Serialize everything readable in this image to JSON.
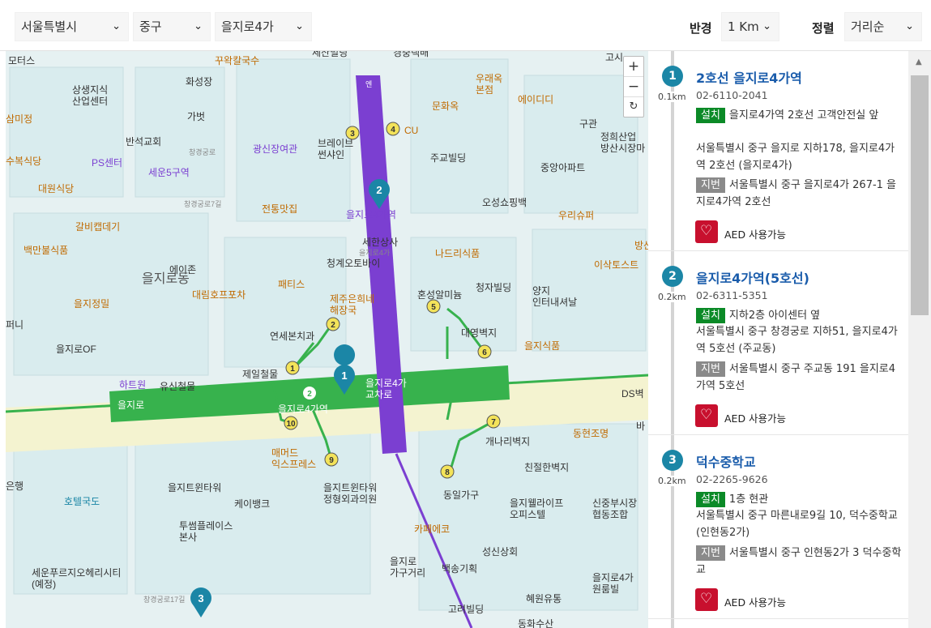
{
  "filters": {
    "city": "서울특별시",
    "district": "중구",
    "dong": "을지로4가",
    "radius_label": "반경",
    "radius": "1 Km",
    "sort_label": "정렬",
    "sort": "거리순"
  },
  "map": {
    "zoom_in": "+",
    "zoom_out": "−",
    "reset": "↻",
    "markers": [
      {
        "num": "1"
      },
      {
        "num": "2"
      },
      {
        "num": "3"
      }
    ],
    "labels": {
      "l1": "모터스",
      "l2": "꾸왁칼국수",
      "l3": "세산빌딩",
      "l4": "경충택배",
      "l5": "고시",
      "l6": "상생지식\n산업센터",
      "l7": "화성장",
      "l8": "삼미정",
      "l9": "가벗",
      "l10": "반석교회",
      "l11": "광신장여관",
      "l12": "브레이브\n썬샤인",
      "l13": "CU",
      "l14": "우래옥\n본점",
      "l15": "에이디디",
      "l16": "문화옥",
      "l17": "구관",
      "l18": "정희산업\n방산시장마",
      "l19": "주교빌딩",
      "l20": "중앙아파트",
      "l21": "수복식당",
      "l22": "PS센터",
      "l23": "세운5구역",
      "l24": "대원식당",
      "l25": "갈비캡데기",
      "l26": "전통맛집",
      "l27": "을지로4가역",
      "l28": "오성쇼핑백",
      "l29": "우리슈퍼",
      "l30": "백만불식품",
      "l31": "세한상사",
      "l32": "나드리식품",
      "l33": "을지로동",
      "l34": "에이존",
      "l35": "청계오토바이",
      "l36": "이삭토스트",
      "l37": "대림호프포차",
      "l38": "패티스",
      "l39": "제주은희네\n해장국",
      "l40": "혼성알미늄",
      "l41": "청자빌딩",
      "l42": "양지\n인터내셔날",
      "l43": "을지정밀",
      "l44": "퍼니",
      "l45": "연세본치과",
      "l46": "대영벽지",
      "l47": "을지로OF",
      "l48": "을지식품",
      "l49": "제일철물",
      "l50": "하트원",
      "l51": "유신철물",
      "l52": "을지로4가\n교차로",
      "l53": "을지로",
      "l54": "을지로4가역",
      "l55": "DS벽",
      "l56": "동현조명",
      "l57": "개나리벽지",
      "l58": "매머드\n익스프레스",
      "l59": "친절한벽지",
      "l60": "을지트윈타워",
      "l61": "케이뱅크",
      "l62": "을지트윈타워\n정형외과의원",
      "l63": "동일가구",
      "l64": "을지웰라이프\n오피스텔",
      "l65": "신중부시장\n협동조합",
      "l66": "호텔국도",
      "l67": "은행",
      "l68": "투썸플레이스\n본사",
      "l69": "카페에코",
      "l70": "성신상회",
      "l71": "세운푸르지오헤리시티\n(예정)",
      "l72": "을지로\n가구거리",
      "l73": "백송기획",
      "l74": "을지로4가\n원룸빌",
      "l75": "혜원유통",
      "l76": "고려빌딩",
      "l77": "창경궁로",
      "l78": "창경궁로7길",
      "l79": "을지로4가",
      "l80": "동화수산",
      "l81": "방산",
      "l82": "바",
      "l83": "창경궁로17길",
      "l84": "엔"
    }
  },
  "list": [
    {
      "num": "1",
      "dist": "0.1km",
      "name": "2호선 을지로4가역",
      "tel": "02-6110-2041",
      "install_tag": "설치",
      "install": "을지로4가역 2호선 고객안전실 앞",
      "addr": "서울특별시 중구 을지로 지하178, 을지로4가역 2호선 (을지로4가)",
      "lot_tag": "지번",
      "lot": "서울특별시 중구 을지로4가 267-1 을지로4가역 2호선",
      "aed_label": "AED 사용가능"
    },
    {
      "num": "2",
      "dist": "0.2km",
      "name": "을지로4가역(5호선)",
      "tel": "02-6311-5351",
      "install_tag": "설치",
      "install": "지하2층 아이센터 옆",
      "addr": "서울특별시 중구 창경궁로 지하51, 을지로4가역 5호선 (주교동)",
      "lot_tag": "지번",
      "lot": "서울특별시 중구 주교동 191 을지로4가역 5호선",
      "aed_label": "AED 사용가능"
    },
    {
      "num": "3",
      "dist": "0.2km",
      "name": "덕수중학교",
      "tel": "02-2265-9626",
      "install_tag": "설치",
      "install": "1층 현관",
      "addr": "서울특별시 중구 마른내로9길 10, 덕수중학교 (인현동2가)",
      "lot_tag": "지번",
      "lot": "서울특별시 중구 인현동2가 3 덕수중학교",
      "aed_label": "AED 사용가능"
    }
  ],
  "colors": {
    "line2": "#37b24d",
    "line5": "#7b3fd1",
    "marker": "#1b86a6",
    "aed": "#c8102e",
    "install": "#0b8a27"
  }
}
